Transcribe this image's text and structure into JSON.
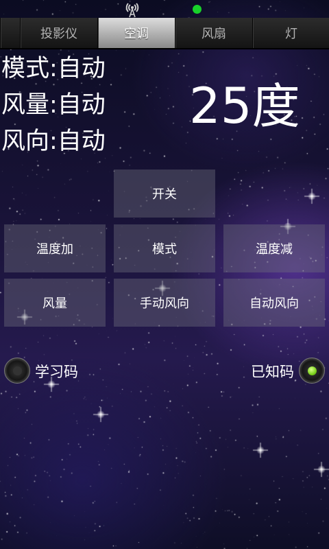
{
  "status_bar": {
    "signal_icon": "signal-tower-icon",
    "indicator_color": "#18d12a"
  },
  "tabs": [
    {
      "label": "投影仪",
      "active": false
    },
    {
      "label": "空调",
      "active": true
    },
    {
      "label": "风扇",
      "active": false
    },
    {
      "label": "灯",
      "active": false
    }
  ],
  "status": {
    "mode": "模式:自动",
    "fan_speed": "风量:自动",
    "fan_direction": "风向:自动"
  },
  "temperature": {
    "value": "25",
    "unit": "度"
  },
  "buttons": {
    "power": "开关",
    "temp_up": "温度加",
    "mode": "模式",
    "temp_down": "温度减",
    "fan_speed": "风量",
    "manual_direction": "手动风向",
    "auto_direction": "自动风向"
  },
  "code_mode": {
    "learn_label": "学习码",
    "learn_selected": false,
    "known_label": "已知码",
    "known_selected": true
  },
  "colors": {
    "accent_green": "#7bd11c"
  }
}
